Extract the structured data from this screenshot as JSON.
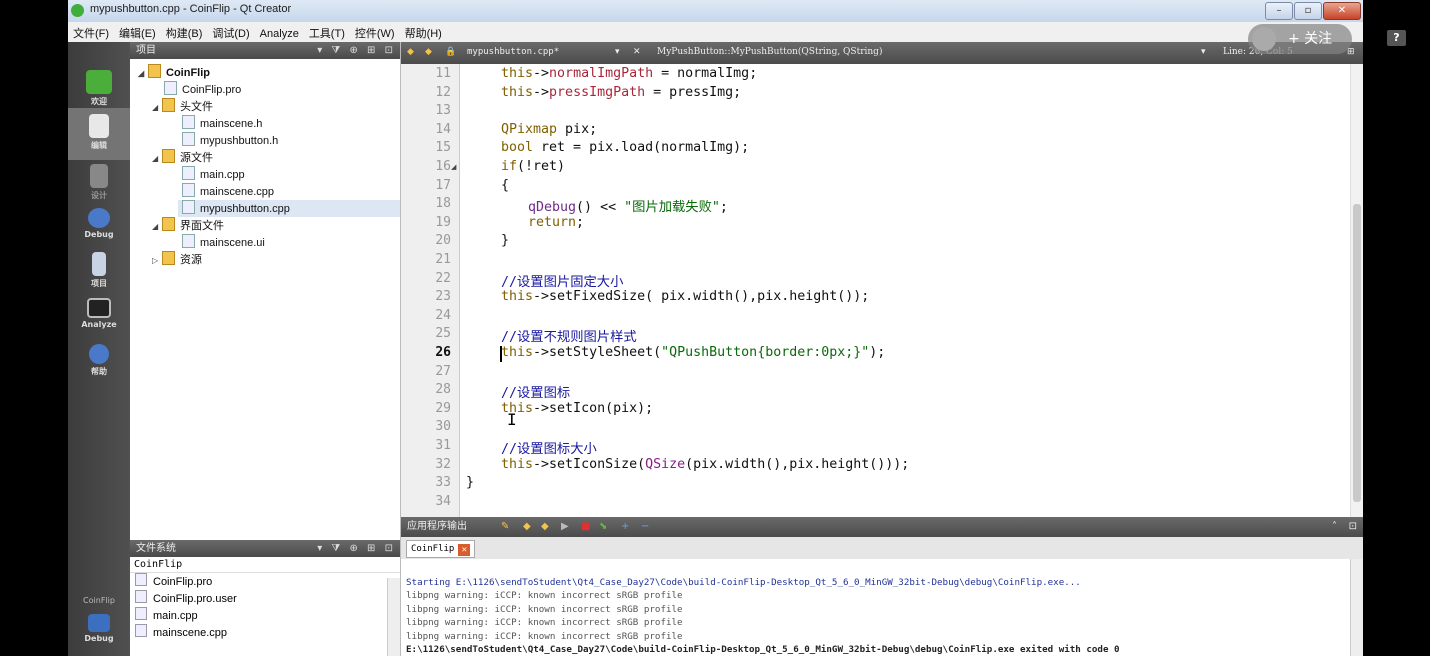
{
  "window": {
    "title": "mypushbutton.cpp - CoinFlip - Qt Creator"
  },
  "menu": [
    "文件(F)",
    "编辑(E)",
    "构建(B)",
    "调试(D)",
    "Analyze",
    "工具(T)",
    "控件(W)",
    "帮助(H)"
  ],
  "modes": [
    {
      "label": "欢迎",
      "icon": "qt-logo-icon"
    },
    {
      "label": "编辑",
      "icon": "edit-document-icon"
    },
    {
      "label": "设计",
      "icon": "design-pen-icon"
    },
    {
      "label": "Debug",
      "icon": "debug-bug-icon"
    },
    {
      "label": "项目",
      "icon": "project-wrench-icon"
    },
    {
      "label": "Analyze",
      "icon": "analyze-monitor-icon"
    },
    {
      "label": "帮助",
      "icon": "help-circle-icon"
    }
  ],
  "build_target": {
    "label": "CoinFlip",
    "mode": "Debug"
  },
  "project_pane": {
    "title": "项目",
    "tree": [
      {
        "label": "CoinFlip",
        "type": "project",
        "depth": 0
      },
      {
        "label": "CoinFlip.pro",
        "type": "pro",
        "depth": 1
      },
      {
        "label": "头文件",
        "type": "folder",
        "depth": 1
      },
      {
        "label": "mainscene.h",
        "type": "header",
        "depth": 2
      },
      {
        "label": "mypushbutton.h",
        "type": "header",
        "depth": 2
      },
      {
        "label": "源文件",
        "type": "folder",
        "depth": 1
      },
      {
        "label": "main.cpp",
        "type": "source",
        "depth": 2
      },
      {
        "label": "mainscene.cpp",
        "type": "source",
        "depth": 2
      },
      {
        "label": "mypushbutton.cpp",
        "type": "source",
        "depth": 2,
        "selected": true
      },
      {
        "label": "界面文件",
        "type": "folder",
        "depth": 1
      },
      {
        "label": "mainscene.ui",
        "type": "ui",
        "depth": 2
      },
      {
        "label": "资源",
        "type": "folder",
        "depth": 1
      }
    ]
  },
  "file_system": {
    "title": "文件系统",
    "folder": "CoinFlip",
    "files": [
      "CoinFlip.pro",
      "CoinFlip.pro.user",
      "main.cpp",
      "mainscene.cpp"
    ]
  },
  "editor": {
    "file_tab": "mypushbutton.cpp*",
    "symbol": "MyPushButton::MyPushButton(QString, QString)",
    "position": "Line: 26, Col: 5",
    "current_line": 26,
    "lines": [
      {
        "n": 11,
        "text": "this->normalImgPath = normalImg;"
      },
      {
        "n": 12,
        "text": "this->pressImgPath = pressImg;"
      },
      {
        "n": 13,
        "text": ""
      },
      {
        "n": 14,
        "text": "QPixmap pix;"
      },
      {
        "n": 15,
        "text": "bool ret = pix.load(normalImg);"
      },
      {
        "n": 16,
        "text": "if(!ret)"
      },
      {
        "n": 17,
        "text": "{"
      },
      {
        "n": 18,
        "text": "qDebug() << \"图片加载失败\";"
      },
      {
        "n": 19,
        "text": "return;"
      },
      {
        "n": 20,
        "text": "}"
      },
      {
        "n": 21,
        "text": ""
      },
      {
        "n": 22,
        "text": "//设置图片固定大小"
      },
      {
        "n": 23,
        "text": "this->setFixedSize( pix.width(),pix.height());"
      },
      {
        "n": 24,
        "text": ""
      },
      {
        "n": 25,
        "text": "//设置不规则图片样式"
      },
      {
        "n": 26,
        "text": "this->setStyleSheet(\"QPushButton{border:0px;}\");"
      },
      {
        "n": 27,
        "text": ""
      },
      {
        "n": 28,
        "text": "//设置图标"
      },
      {
        "n": 29,
        "text": "this->setIcon(pix);"
      },
      {
        "n": 30,
        "text": ""
      },
      {
        "n": 31,
        "text": "//设置图标大小"
      },
      {
        "n": 32,
        "text": "this->setIconSize(QSize(pix.width(),pix.height()));"
      },
      {
        "n": 33,
        "text": "}"
      },
      {
        "n": 34,
        "text": ""
      }
    ]
  },
  "output": {
    "title": "应用程序输出",
    "tab": "CoinFlip",
    "lines": [
      "Starting E:\\1126\\sendToStudent\\Qt4_Case_Day27\\Code\\build-CoinFlip-Desktop_Qt_5_6_0_MinGW_32bit-Debug\\debug\\CoinFlip.exe...",
      "libpng warning: iCCP: known incorrect sRGB profile",
      "libpng warning: iCCP: known incorrect sRGB profile",
      "libpng warning: iCCP: known incorrect sRGB profile",
      "libpng warning: iCCP: known incorrect sRGB profile",
      "E:\\1126\\sendToStudent\\Qt4_Case_Day27\\Code\\build-CoinFlip-Desktop_Qt_5_6_0_MinGW_32bit-Debug\\debug\\CoinFlip.exe exited with code 0"
    ]
  },
  "overlay": {
    "follow_label": "+ 关注",
    "help_label": "?"
  },
  "colors": {
    "keyword": "#806000",
    "member": "#a8283a",
    "string": "#0a6a0a",
    "comment": "#1a1aa0",
    "function": "#6d2a8a"
  }
}
